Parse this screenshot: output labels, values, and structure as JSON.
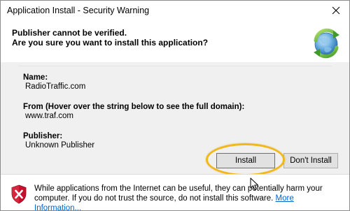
{
  "window": {
    "title": "Application Install - Security Warning"
  },
  "header": {
    "line1": "Publisher cannot be verified.",
    "line2": "Are you sure you want to install this application?"
  },
  "details": {
    "name_label": "Name:",
    "name_value": "RadioTraffic.com",
    "from_label": "From (Hover over the string below to see the full domain):",
    "from_value": "www.traf.com",
    "publisher_label": "Publisher:",
    "publisher_value": "Unknown Publisher"
  },
  "buttons": {
    "install_label": "Install",
    "dont_install_label": "Don't Install"
  },
  "footer": {
    "warning_text": "While applications from the Internet can be useful, they can potentially harm your computer. If you do not trust the source, do not install this software. ",
    "more_info_label": "More Information..."
  },
  "colors": {
    "highlight_ring": "#f0b81a",
    "link": "#0066cc",
    "shield_red": "#c8102e"
  },
  "icons": {
    "close": "close-icon",
    "app": "globe-install-icon",
    "warning": "warning-shield-icon",
    "pointer": "mouse-cursor-icon"
  }
}
